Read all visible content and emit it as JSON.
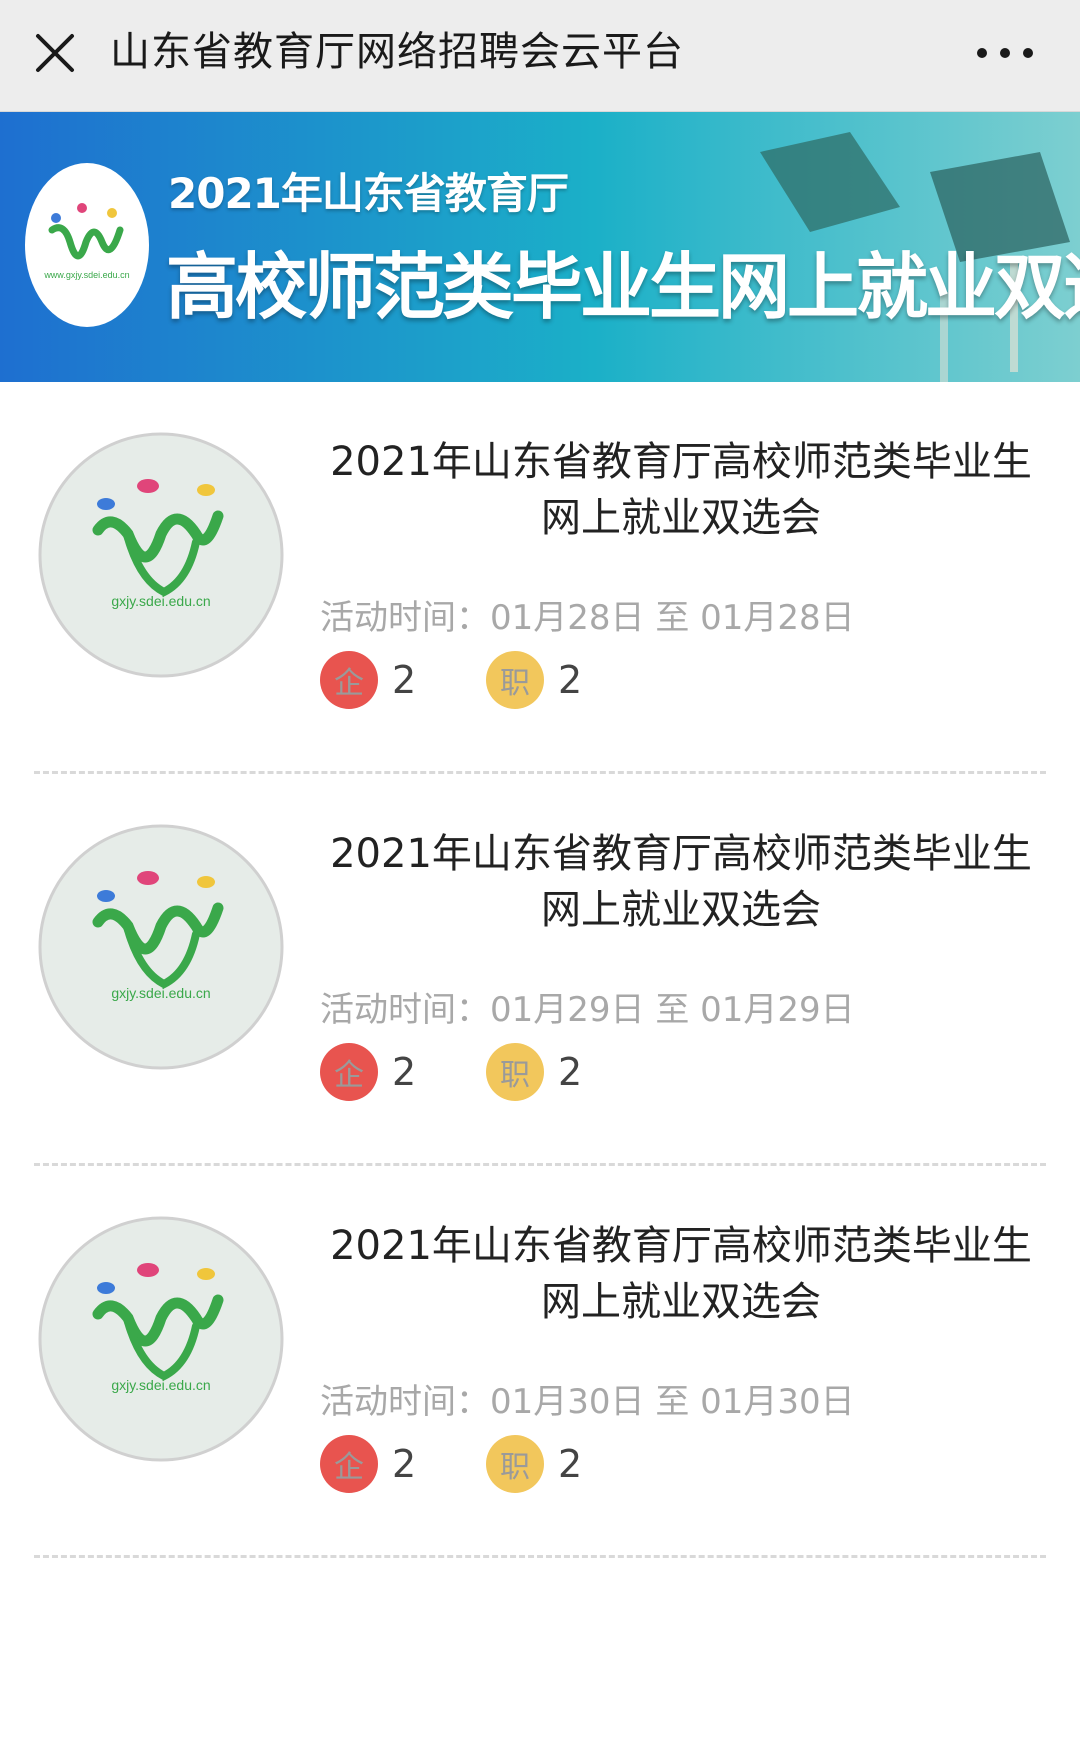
{
  "nav": {
    "title": "山东省教育厅网络招聘会云平台",
    "close_icon": "close-icon",
    "more_icon": "more-dots-icon"
  },
  "banner": {
    "subtitle": "2021年山东省教育厅",
    "main_title": "高校师范类毕业生网上就业双选会",
    "logo_text": "www.gxjy.sdei.edu.cn",
    "colors": {
      "start": "#1e6fd0",
      "mid": "#1bb0c8",
      "end": "#7dcfd0"
    }
  },
  "events": [
    {
      "title": "2021年山东省教育厅高校师范类毕业生网上就业双选会",
      "time_label": "活动时间：",
      "time_range": "01月28日 至 01月28日",
      "enterprise_badge": "企",
      "enterprise_count": "2",
      "job_badge": "职",
      "job_count": "2",
      "logo_text": "gxjy.sdei.edu.cn"
    },
    {
      "title": "2021年山东省教育厅高校师范类毕业生网上就业双选会",
      "time_label": "活动时间：",
      "time_range": "01月29日 至 01月29日",
      "enterprise_badge": "企",
      "enterprise_count": "2",
      "job_badge": "职",
      "job_count": "2",
      "logo_text": "gxjy.sdei.edu.cn"
    },
    {
      "title": "2021年山东省教育厅高校师范类毕业生网上就业双选会",
      "time_label": "活动时间：",
      "time_range": "01月30日 至 01月30日",
      "enterprise_badge": "企",
      "enterprise_count": "2",
      "job_badge": "职",
      "job_count": "2",
      "logo_text": "gxjy.sdei.edu.cn"
    }
  ],
  "colors": {
    "enterprise_badge": "#e8544f",
    "job_badge": "#f2c75c",
    "logo_green": "#3aa84a"
  }
}
